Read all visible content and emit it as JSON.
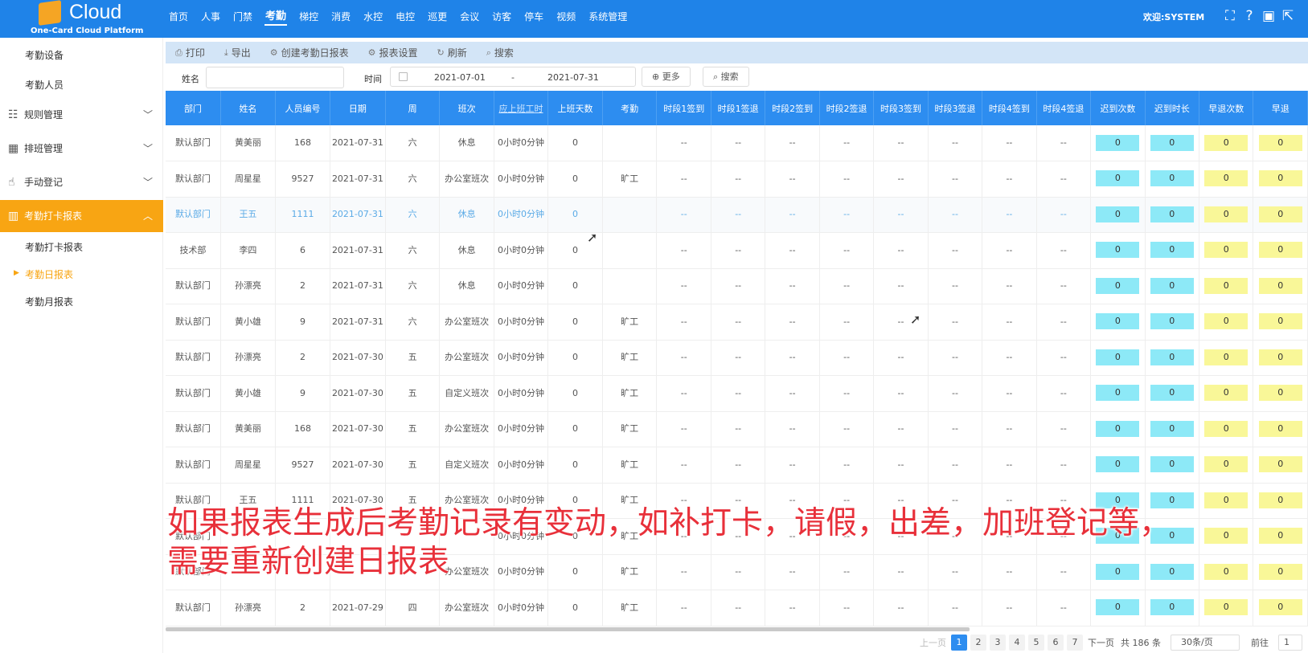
{
  "app": {
    "brand": "Cloud",
    "subtitle": "One-Card Cloud Platform",
    "welcome": "欢迎:SYSTEM"
  },
  "nav": [
    "首页",
    "人事",
    "门禁",
    "考勤",
    "梯控",
    "消费",
    "水控",
    "电控",
    "巡更",
    "会议",
    "访客",
    "停车",
    "视频",
    "系统管理"
  ],
  "nav_active": "考勤",
  "sidebar": {
    "top_items": [
      "考勤设备",
      "考勤人员"
    ],
    "groups": [
      {
        "label": "规则管理",
        "icon": "rules-icon"
      },
      {
        "label": "排班管理",
        "icon": "calendar-icon"
      },
      {
        "label": "手动登记",
        "icon": "hand-icon"
      },
      {
        "label": "考勤打卡报表",
        "icon": "chart-icon"
      }
    ],
    "sub_items": [
      "考勤打卡报表",
      "考勤日报表",
      "考勤月报表"
    ],
    "active_sub": "考勤日报表"
  },
  "toolbar": [
    "打印",
    "导出",
    "创建考勤日报表",
    "报表设置",
    "刷新",
    "搜索"
  ],
  "filter": {
    "name_label": "姓名",
    "time_label": "时间",
    "date_from": "2021-07-01",
    "date_sep": "-",
    "date_to": "2021-07-31",
    "more_label": "更多",
    "search_label": "搜索"
  },
  "table": {
    "headers": [
      "部门",
      "姓名",
      "人员编号",
      "日期",
      "周",
      "班次",
      "应上班工时",
      "上班天数",
      "考勤",
      "时段1签到",
      "时段1签退",
      "时段2签到",
      "时段2签退",
      "时段3签到",
      "时段3签退",
      "时段4签到",
      "时段4签退",
      "迟到次数",
      "迟到时长",
      "早退次数",
      "早退"
    ],
    "rows": [
      [
        "默认部门",
        "黄美丽",
        "168",
        "2021-07-31",
        "六",
        "休息",
        "0小时0分钟",
        "0",
        ""
      ],
      [
        "默认部门",
        "周星星",
        "9527",
        "2021-07-31",
        "六",
        "办公室班次",
        "0小时0分钟",
        "0",
        "旷工"
      ],
      [
        "默认部门",
        "王五",
        "1111",
        "2021-07-31",
        "六",
        "休息",
        "0小时0分钟",
        "0",
        ""
      ],
      [
        "技术部",
        "李四",
        "6",
        "2021-07-31",
        "六",
        "休息",
        "0小时0分钟",
        "0",
        ""
      ],
      [
        "默认部门",
        "孙漂亮",
        "2",
        "2021-07-31",
        "六",
        "休息",
        "0小时0分钟",
        "0",
        ""
      ],
      [
        "默认部门",
        "黄小雄",
        "9",
        "2021-07-31",
        "六",
        "办公室班次",
        "0小时0分钟",
        "0",
        "旷工"
      ],
      [
        "默认部门",
        "孙漂亮",
        "2",
        "2021-07-30",
        "五",
        "办公室班次",
        "0小时0分钟",
        "0",
        "旷工"
      ],
      [
        "默认部门",
        "黄小雄",
        "9",
        "2021-07-30",
        "五",
        "自定义班次",
        "0小时0分钟",
        "0",
        "旷工"
      ],
      [
        "默认部门",
        "黄美丽",
        "168",
        "2021-07-30",
        "五",
        "办公室班次",
        "0小时0分钟",
        "0",
        "旷工"
      ],
      [
        "默认部门",
        "周星星",
        "9527",
        "2021-07-30",
        "五",
        "自定义班次",
        "0小时0分钟",
        "0",
        "旷工"
      ],
      [
        "默认部门",
        "王五",
        "1111",
        "2021-07-30",
        "五",
        "办公室班次",
        "0小时0分钟",
        "0",
        "旷工"
      ],
      [
        "默认部门",
        "",
        "",
        "",
        "",
        "",
        "0小时0分钟",
        "0",
        "旷工"
      ],
      [
        "默认部门",
        "",
        "",
        "",
        "",
        "办公室班次",
        "0小时0分钟",
        "0",
        "旷工"
      ],
      [
        "默认部门",
        "孙漂亮",
        "2",
        "2021-07-29",
        "四",
        "办公室班次",
        "0小时0分钟",
        "0",
        "旷工"
      ]
    ],
    "highlight_row": 2,
    "dash": "--",
    "zero": "0"
  },
  "pager": {
    "prev": "上一页",
    "pages": [
      "1",
      "2",
      "3",
      "4",
      "5",
      "6",
      "7"
    ],
    "current": "1",
    "next": "下一页",
    "total": "共 186 条",
    "per_page": "30条/页",
    "goto": "前往",
    "goto_value": "1"
  },
  "caption": {
    "line1": "如果报表生成后考勤记录有变动，如补打卡，请假，出差，加班登记等，",
    "line2": "需要重新创建日报表"
  },
  "colors": {
    "topbar": "#1f83e8",
    "header": "#2d8df0",
    "active": "#f8a513",
    "cyan": "#8de9f7",
    "yellow": "#f9f798",
    "caption": "#e8303a"
  }
}
